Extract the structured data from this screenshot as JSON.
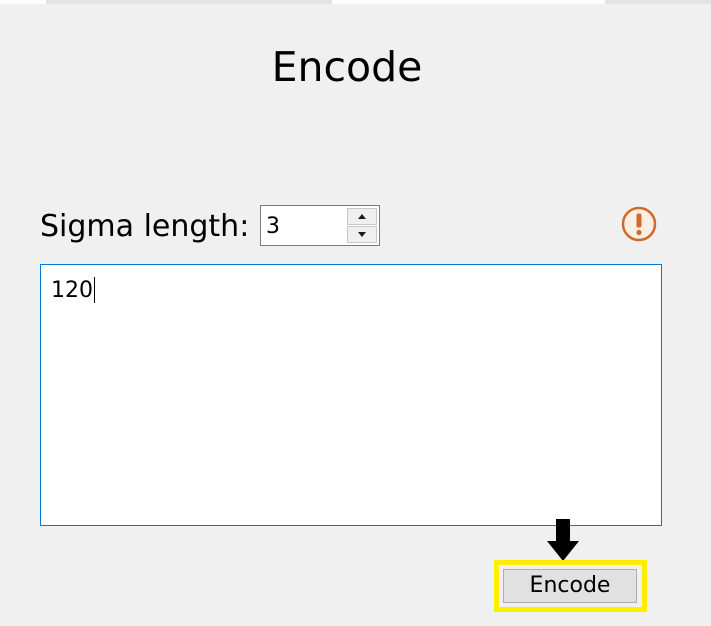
{
  "header": {
    "title": "Encode"
  },
  "sigma": {
    "label": "Sigma length:",
    "value": "3"
  },
  "input": {
    "text": "120"
  },
  "actions": {
    "encode_label": "Encode"
  },
  "icons": {
    "warning": "exclamation-circle-icon",
    "pointer": "down-arrow-icon",
    "spin_up": "triangle-up-icon",
    "spin_down": "triangle-down-icon"
  },
  "colors": {
    "window_background": "#f0f0f0",
    "warning": "#d06a2a",
    "highlight": "#ffee00",
    "text_area_border": "#0078d7",
    "button_background": "#e1e1e1"
  }
}
